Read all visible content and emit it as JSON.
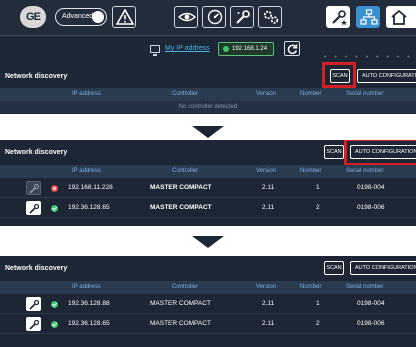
{
  "topbar": {
    "logo_text": "GE",
    "advanced_label": "Advanced",
    "icons": [
      "warning-icon",
      "eye-icon",
      "gauge-icon",
      "wrench-icon",
      "settings-icon",
      "wrench-star-icon",
      "network-icon",
      "home-icon"
    ]
  },
  "network": {
    "my_ip_link": "My IP address",
    "my_ip_value": "192.168.1.24",
    "dots": "• • • • • • • • • •"
  },
  "discovery": {
    "title": "Network discovery",
    "scan_label": "SCAN",
    "auto_config_label": "AUTO CONFIGURATION",
    "columns": [
      "IP address",
      "Controller",
      "Version",
      "Number",
      "Serial number"
    ],
    "no_controller": "No controller detected"
  },
  "step2": {
    "rows": [
      {
        "status": "error",
        "ip": "192.168.11.228",
        "controller": "MASTER COMPACT",
        "version": "2.11",
        "number": "1",
        "serial": "0198-004"
      },
      {
        "status": "ok",
        "ip": "192.36.128.65",
        "controller": "MASTER COMPACT",
        "version": "2.11",
        "number": "2",
        "serial": "0198-006"
      }
    ]
  },
  "step3": {
    "rows": [
      {
        "status": "ok",
        "ip": "192.36.128.88",
        "controller": "MASTER COMPACT",
        "version": "2.11",
        "number": "1",
        "serial": "0198-004"
      },
      {
        "status": "ok",
        "ip": "192.36.128.65",
        "controller": "MASTER COMPACT",
        "version": "2.11",
        "number": "2",
        "serial": "0198-006"
      }
    ]
  },
  "colors": {
    "background": "#1c2635",
    "header_text": "#7fb2e0",
    "highlight": "#d31f26",
    "status_ok": "#3ec46d",
    "status_error": "#e03b3b",
    "link": "#4fb2e6"
  }
}
